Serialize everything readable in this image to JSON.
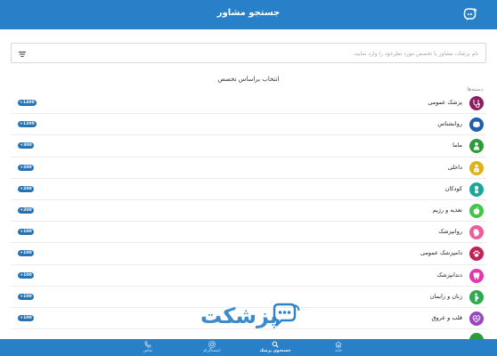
{
  "header": {
    "title": "جستجو مشاور"
  },
  "search": {
    "placeholder": "نام پزشک، مشاور یا تخصص مورد نظرخود را وارد نمایید."
  },
  "heading": "انتخاب براساس تخصص",
  "section_label": "دسته‌ها",
  "categories": [
    {
      "label": "پزشک عمومی",
      "count": "+1400",
      "color": "#8e1e63",
      "icon": "stethoscope-icon"
    },
    {
      "label": "روانشناس",
      "count": "+1200",
      "color": "#1e5fae",
      "icon": "brain-icon"
    },
    {
      "label": "ماما",
      "count": "+300",
      "color": "#2f9a3a",
      "icon": "midwife-icon"
    },
    {
      "label": "داخلی",
      "count": "+200",
      "color": "#e0b21a",
      "icon": "internal-doctor-icon"
    },
    {
      "label": "کودکان",
      "count": "+200",
      "color": "#18a89a",
      "icon": "baby-icon"
    },
    {
      "label": "تغذیه و رژیم",
      "count": "+200",
      "color": "#45c44a",
      "icon": "apple-icon"
    },
    {
      "label": "روانپزشک",
      "count": "+100",
      "color": "#ee5c9c",
      "icon": "psychiatrist-icon"
    },
    {
      "label": "دامپزشک عمومی",
      "count": "+100",
      "color": "#c42158",
      "icon": "paw-icon"
    },
    {
      "label": "دندانپزشک",
      "count": "+100",
      "color": "#e238ae",
      "icon": "tooth-icon"
    },
    {
      "label": "زنان و زایمان",
      "count": "+100",
      "color": "#2faa4e",
      "icon": "pregnancy-icon"
    },
    {
      "label": "قلب و عروق",
      "count": "+100",
      "color": "#9a46c2",
      "icon": "heart-icon"
    }
  ],
  "watermark": {
    "text": "پزشکت"
  },
  "bottom_nav": [
    {
      "label": "تماس",
      "icon": "phone-icon"
    },
    {
      "label": "اینستاگرام",
      "icon": "instagram-icon"
    },
    {
      "label": "جستجوی پزشک",
      "icon": "search-icon",
      "active": true
    },
    {
      "label": "خانه",
      "icon": "home-icon"
    }
  ],
  "colors": {
    "primary": "#2880c8",
    "badge": "#2672b2"
  }
}
